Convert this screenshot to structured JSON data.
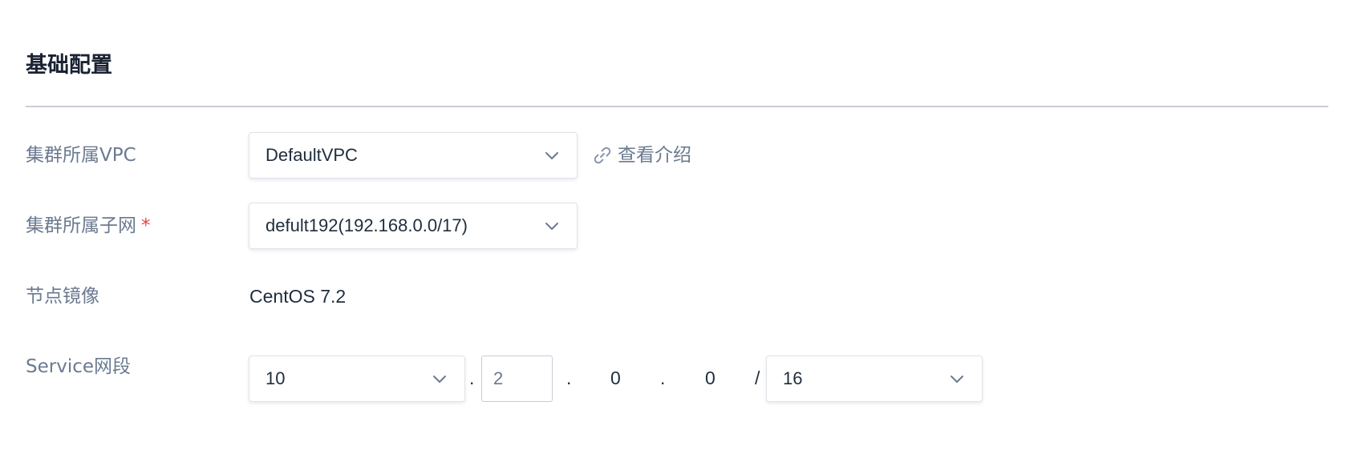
{
  "section": {
    "title": "基础配置"
  },
  "vpc": {
    "label": "集群所属VPC",
    "value": "DefaultVPC",
    "link_text": "查看介绍"
  },
  "subnet": {
    "label": "集群所属子网",
    "required_mark": "*",
    "value": "defult192(192.168.0.0/17)"
  },
  "image": {
    "label": "节点镜像",
    "value": "CentOS 7.2"
  },
  "service_cidr": {
    "label": "Service网段",
    "first_octet": "10",
    "second_octet": "2",
    "third_octet": "0",
    "fourth_octet": "0",
    "dot": ".",
    "slash": "/",
    "mask": "16"
  },
  "colors": {
    "accent_text": "#1f2d3d",
    "label_text": "#6b7a90",
    "required": "#e8453c",
    "divider": "#c9ced8"
  }
}
